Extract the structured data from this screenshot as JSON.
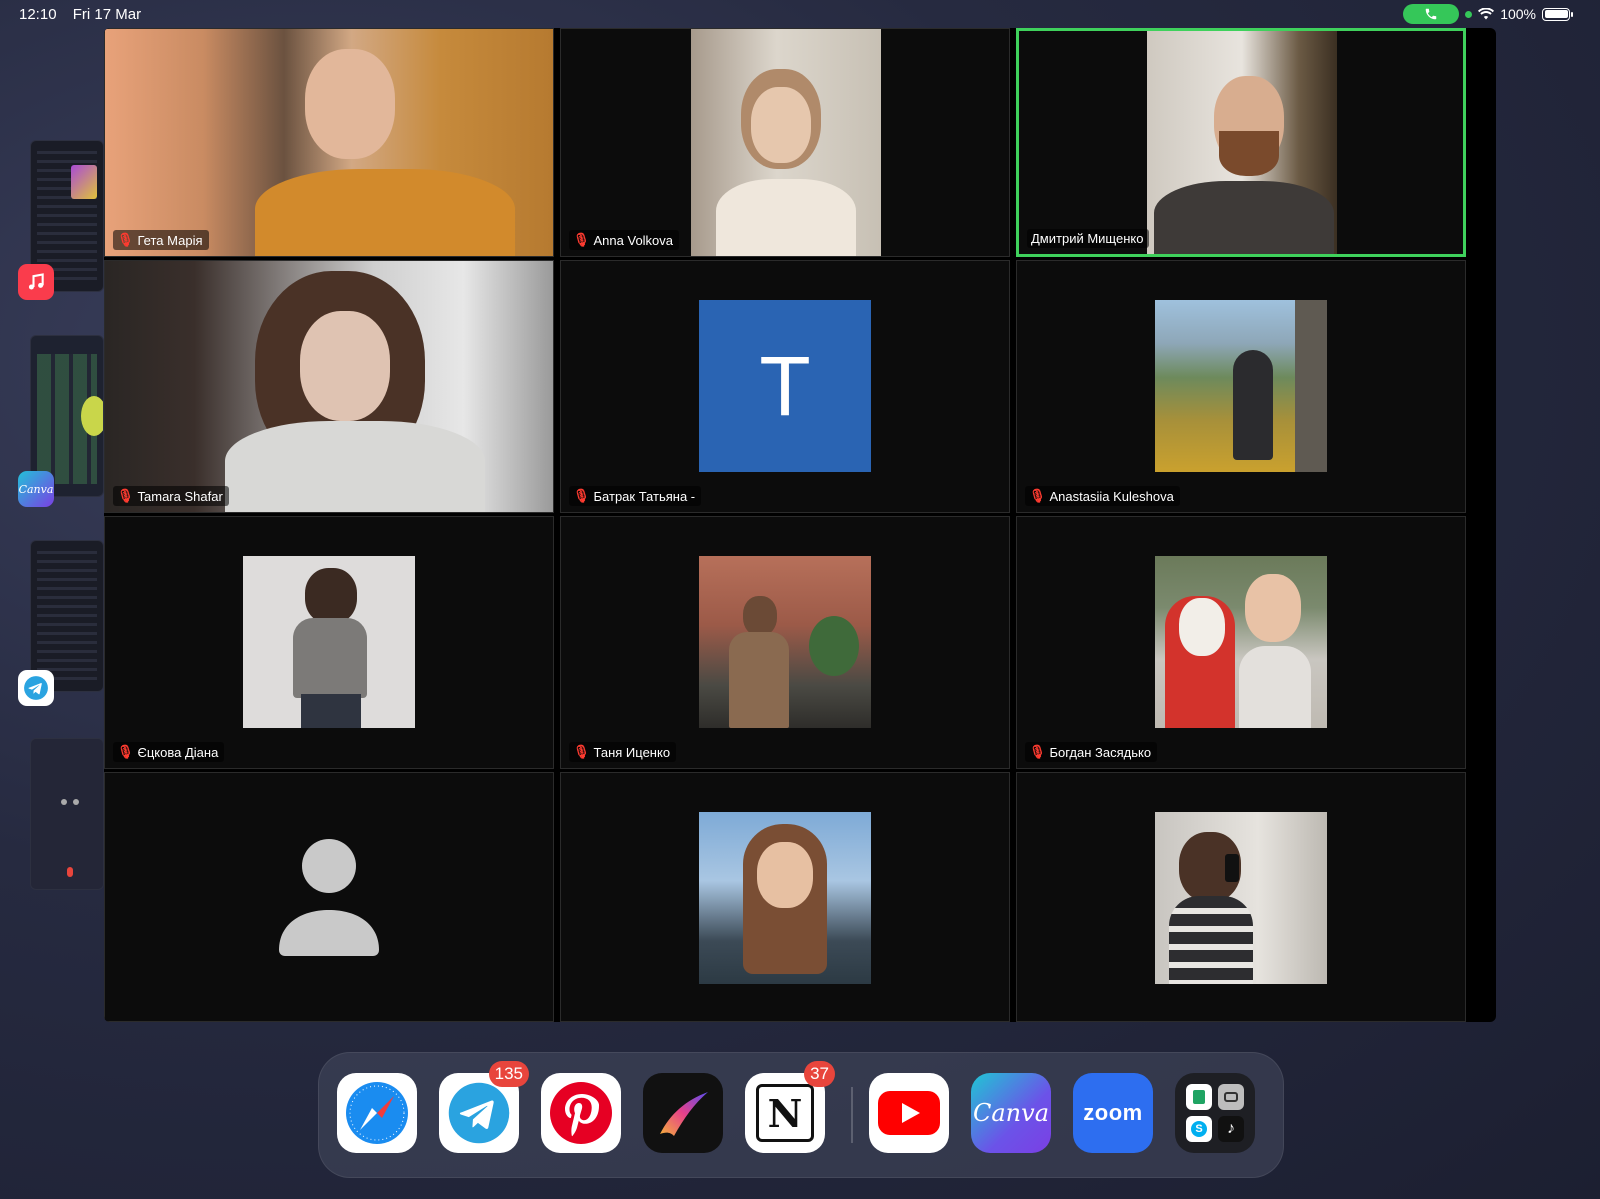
{
  "status_bar": {
    "time": "12:10",
    "date": "Fri 17 Mar",
    "battery": "100%"
  },
  "meeting": {
    "active_speaker": "Дмитрий Мищенко",
    "tiles": [
      {
        "name": "Гета Марія",
        "muted": true,
        "kind": "video"
      },
      {
        "name": "Anna Volkova",
        "muted": true,
        "kind": "video"
      },
      {
        "name": "Дмитрий Мищенко",
        "muted": false,
        "kind": "video",
        "active": true
      },
      {
        "name": "Tamara Shafar",
        "muted": true,
        "kind": "video"
      },
      {
        "name": "Батрак Татьяна -",
        "muted": true,
        "kind": "initial",
        "initial": "T"
      },
      {
        "name": "Anastasiia Kuleshova",
        "muted": true,
        "kind": "photo"
      },
      {
        "name": "Єцкова Діана",
        "muted": true,
        "kind": "photo"
      },
      {
        "name": "Таня Иценко",
        "muted": true,
        "kind": "photo"
      },
      {
        "name": "Богдан Засядько",
        "muted": true,
        "kind": "photo"
      },
      {
        "name": "",
        "muted": false,
        "kind": "placeholder"
      },
      {
        "name": "",
        "muted": false,
        "kind": "photo"
      },
      {
        "name": "",
        "muted": false,
        "kind": "photo"
      }
    ]
  },
  "side_apps": [
    {
      "icon": "music-icon",
      "color": "#fa3c4c"
    },
    {
      "icon": "canva-icon",
      "label": "Canva",
      "color": "#7b3fe4"
    },
    {
      "icon": "telegram-icon",
      "color": "#2aa3e0"
    }
  ],
  "dock": {
    "apps": [
      {
        "icon": "safari-icon",
        "label": "Safari"
      },
      {
        "icon": "telegram-icon",
        "label": "Telegram",
        "badge": "135"
      },
      {
        "icon": "pinterest-icon",
        "label": "Pinterest"
      },
      {
        "icon": "procreate-icon",
        "label": "Procreate"
      },
      {
        "icon": "notion-icon",
        "label": "Notion",
        "badge": "37",
        "glyph": "N"
      },
      {
        "icon": "youtube-icon",
        "label": "YouTube"
      },
      {
        "icon": "canva-icon",
        "label": "Canva",
        "glyph": "Canva"
      },
      {
        "icon": "zoom-icon",
        "label": "zoom",
        "glyph": "zoom"
      },
      {
        "icon": "app-folder-icon",
        "label": "Folder"
      }
    ]
  }
}
